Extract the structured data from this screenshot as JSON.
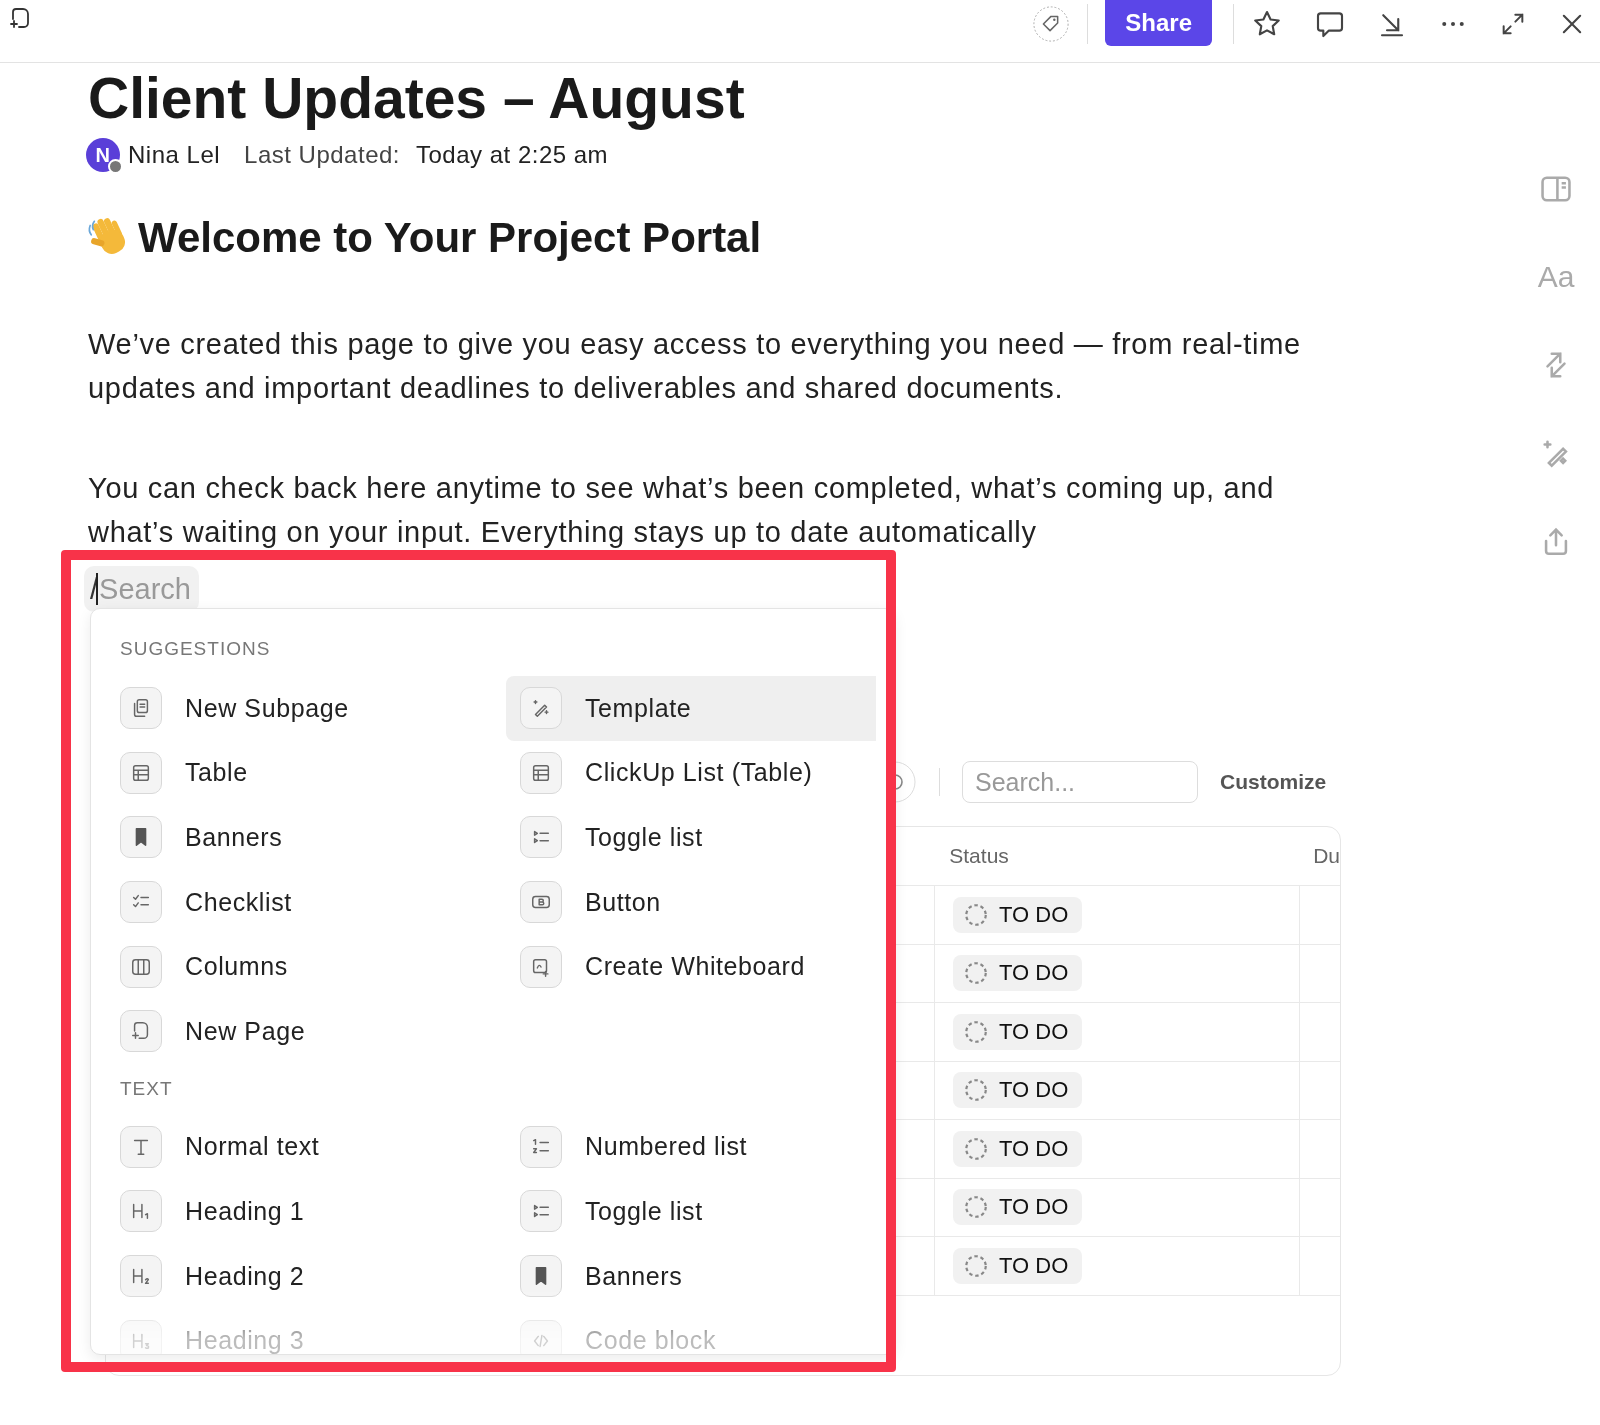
{
  "top_bar": {
    "share_button": "Share"
  },
  "document": {
    "title": "Client Updates – August",
    "author": {
      "initial": "N",
      "name": "Nina Lel"
    },
    "last_updated_label": "Last Updated:",
    "last_updated": "Today at 2:25 am",
    "heading": "Welcome to Your Project Portal",
    "paragraphs": [
      "We’ve created this page to give you easy access to everything you need — from real-time updates and important deadlines to deliverables and shared documents.",
      "You can check back here anytime to see what’s been completed, what’s coming up, and what’s waiting on your input. Everything stays up to date automatically"
    ]
  },
  "side_tools": [
    {
      "kind": "layout"
    },
    {
      "kind": "font",
      "label": "Aa"
    },
    {
      "kind": "swap"
    },
    {
      "kind": "magic"
    },
    {
      "kind": "export"
    }
  ],
  "table": {
    "search_placeholder": "Search...",
    "customize": "Customize",
    "columns": [
      "Status",
      "Du"
    ],
    "rows": [
      {
        "status": "TO DO"
      },
      {
        "status": "TO DO"
      },
      {
        "status": "TO DO"
      },
      {
        "status": "TO DO"
      },
      {
        "status": "TO DO"
      },
      {
        "status": "TO DO"
      },
      {
        "status": "TO DO"
      }
    ]
  },
  "slash_menu": {
    "value": "/",
    "placeholder": "Search",
    "sections": [
      {
        "title": "SUGGESTIONS",
        "items": [
          {
            "label": "New Subpage",
            "kind": "subpage",
            "selected": false
          },
          {
            "label": "Template",
            "kind": "template",
            "selected": true
          },
          {
            "label": "Table",
            "kind": "table",
            "selected": false
          },
          {
            "label": "ClickUp List (Table)",
            "kind": "table",
            "selected": false
          },
          {
            "label": "Banners",
            "kind": "banner",
            "selected": false
          },
          {
            "label": "Toggle list",
            "kind": "toggle",
            "selected": false
          },
          {
            "label": "Checklist",
            "kind": "checklist",
            "selected": false
          },
          {
            "label": "Button",
            "kind": "button",
            "selected": false
          },
          {
            "label": "Columns",
            "kind": "columns",
            "selected": false
          },
          {
            "label": "Create Whiteboard",
            "kind": "whiteboard",
            "selected": false
          },
          {
            "label": "New Page",
            "kind": "page",
            "selected": false
          }
        ]
      },
      {
        "title": "TEXT",
        "items": [
          {
            "label": "Normal text",
            "kind": "text",
            "selected": false
          },
          {
            "label": "Numbered list",
            "kind": "numbered",
            "selected": false
          },
          {
            "label": "Heading 1",
            "kind": "h1",
            "selected": false
          },
          {
            "label": "Toggle list",
            "kind": "toggle",
            "selected": false
          },
          {
            "label": "Heading 2",
            "kind": "h2",
            "selected": false
          },
          {
            "label": "Banners",
            "kind": "banner",
            "selected": false
          },
          {
            "label": "Heading 3",
            "kind": "h3",
            "selected": false
          },
          {
            "label": "Code block",
            "kind": "code",
            "selected": false
          }
        ]
      }
    ]
  }
}
